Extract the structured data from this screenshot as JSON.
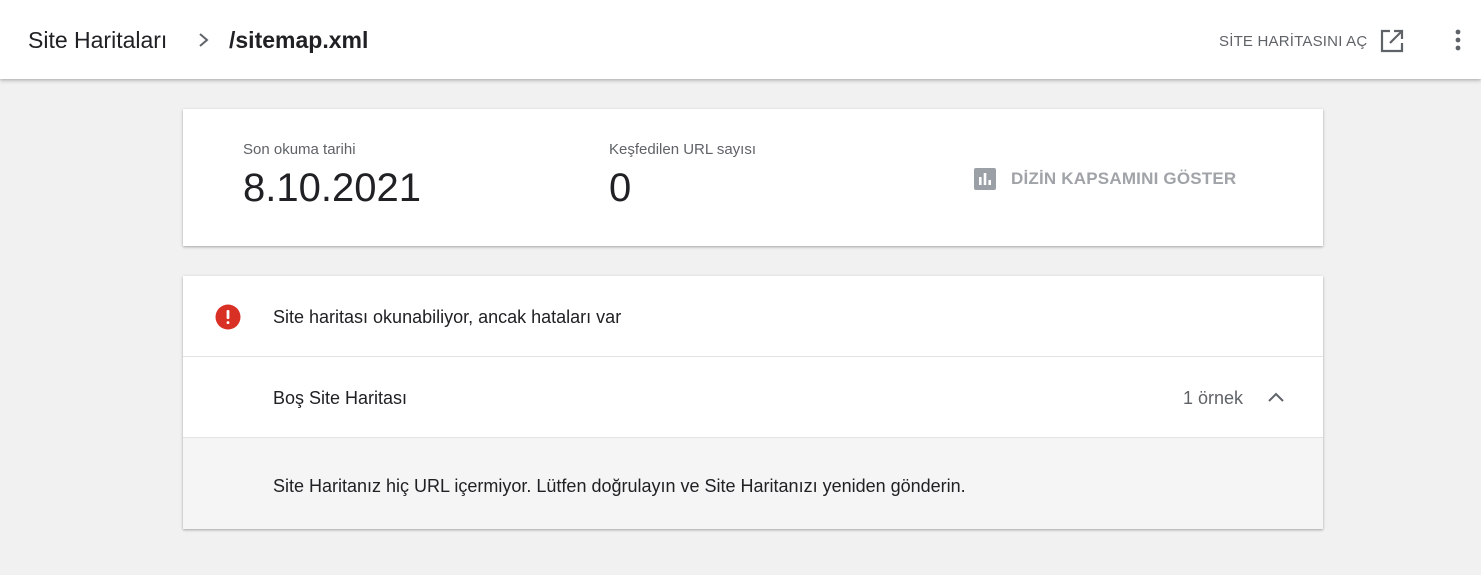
{
  "header": {
    "breadcrumb_root": "Site Haritaları",
    "breadcrumb_current": "/sitemap.xml",
    "open_sitemap_label": "SİTE HARİTASINI AÇ",
    "icons": {
      "separator": "chevron-right-icon",
      "open": "open-in-new-icon",
      "more": "more-vert-icon"
    }
  },
  "summary": {
    "last_read_label": "Son okuma tarihi",
    "last_read_value": "8.10.2021",
    "discovered_urls_label": "Keşfedilen URL sayısı",
    "discovered_urls_value": "0",
    "coverage_button_label": "DİZİN KAPSAMINI GÖSTER",
    "coverage_icon": "bar-chart-icon"
  },
  "errors": {
    "status_text": "Site haritası okunabiliyor, ancak hataları var",
    "status_icon": "error-icon",
    "issues": [
      {
        "name": "Boş Site Haritası",
        "count_label": "1 örnek",
        "detail": "Site Haritanız hiç URL içermiyor. Lütfen doğrulayın ve Site Haritanızı yeniden gönderin."
      }
    ]
  },
  "colors": {
    "background": "#f1f1f1",
    "card": "#ffffff",
    "error_red": "#d93025",
    "muted_text": "#5f6368",
    "disabled_text": "#a0a3a7",
    "primary_text": "#202124"
  }
}
